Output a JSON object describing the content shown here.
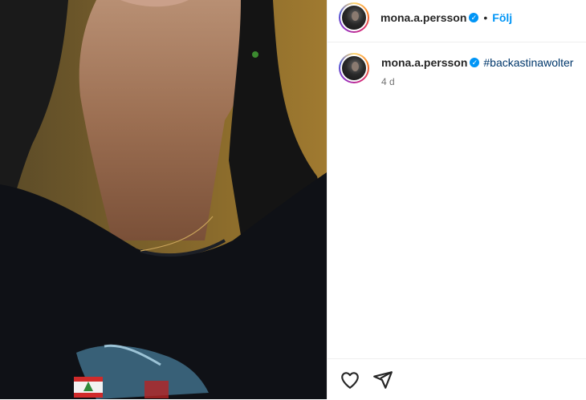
{
  "post": {
    "image_alt": "",
    "author": {
      "username": "mona.a.persson",
      "verified": true
    },
    "header": {
      "separator": "•",
      "follow_label": "Följ"
    },
    "caption": {
      "username": "mona.a.persson",
      "text": "#backastinawolter"
    },
    "timestamp": "4 d",
    "icons": {
      "like": "heart-outline-icon",
      "share": "paper-plane-icon",
      "verified": "verified-badge-icon"
    },
    "colors": {
      "accent": "#0095f6",
      "hashtag": "#00376b",
      "muted": "#737373"
    }
  }
}
